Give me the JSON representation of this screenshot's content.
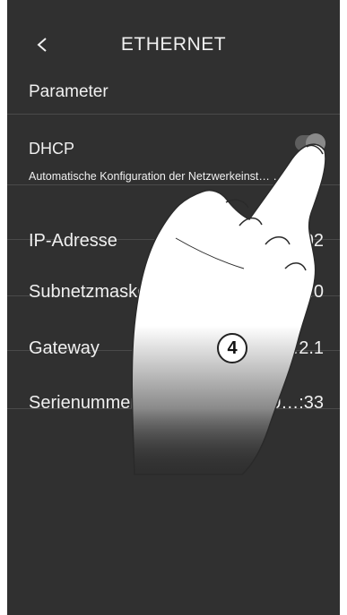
{
  "header": {
    "title": "ETHERNET",
    "back_icon": "chevron-left-icon"
  },
  "section": {
    "title": "Parameter"
  },
  "dhcp": {
    "label": "DHCP",
    "description": "Automatische Konfiguration der Netzwerkeinst… …n",
    "toggle_on": true
  },
  "rows": [
    {
      "label": "IP-Adresse",
      "value": "….2.102"
    },
    {
      "label": "Subnetzmaske",
      "value": "…55.0"
    },
    {
      "label": "Gateway",
      "value": "92.16…2.1"
    },
    {
      "label": "Serienummer",
      "value": "00:03:50:c0:0…:33"
    }
  ],
  "overlay": {
    "step_number": "4",
    "icon": "pointing-hand-icon"
  },
  "colors": {
    "background": "#303030",
    "text": "#f0f0f0",
    "divider": "#4a4a4a"
  }
}
